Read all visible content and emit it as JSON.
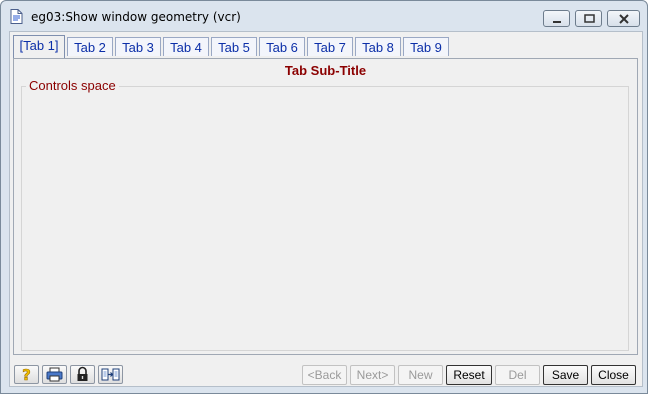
{
  "window": {
    "title": "eg03:Show window geometry (vcr)"
  },
  "tabs": [
    {
      "label": "[Tab 1]"
    },
    {
      "label": "Tab 2"
    },
    {
      "label": "Tab 3"
    },
    {
      "label": "Tab 4"
    },
    {
      "label": "Tab 5"
    },
    {
      "label": "Tab 6"
    },
    {
      "label": "Tab 7"
    },
    {
      "label": "Tab 8"
    },
    {
      "label": "Tab 9"
    }
  ],
  "panel": {
    "subtitle": "Tab Sub-Title",
    "group_label": "Controls space"
  },
  "toolbar": {
    "icons": [
      "help-icon",
      "print-icon",
      "lock-icon",
      "export-icon"
    ]
  },
  "actions": {
    "back": "<Back",
    "next": "Next>",
    "new": "New",
    "reset": "Reset",
    "del": "Del",
    "save": "Save",
    "close": "Close"
  },
  "colors": {
    "subtitle": "#8b0000",
    "tab_text": "#0c2fa8",
    "panel_bg": "#f0f0f0"
  }
}
